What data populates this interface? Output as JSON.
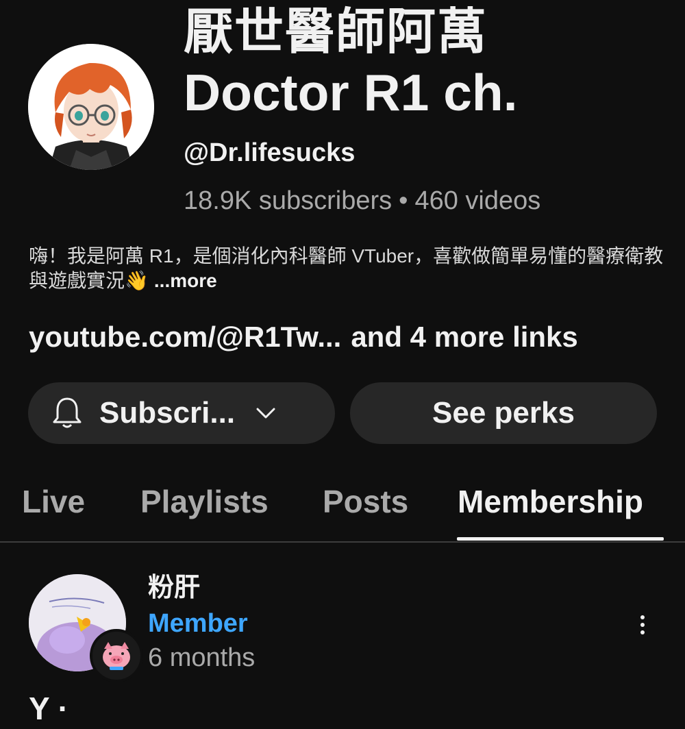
{
  "channel": {
    "title_zh": "厭世醫師阿萬",
    "title_en": "Doctor R1 ch.",
    "handle": "@Dr.lifesucks",
    "subscribers": "18.9K subscribers",
    "separator": "•",
    "videos": "460 videos",
    "description": "嗨！我是阿萬 R1，是個消化內科醫師 VTuber，喜歡做簡單易懂的醫療衛教與遊戲實況",
    "description_emoji": "👋",
    "more_label": "...more",
    "link_text": "youtube.com/@R1Tw...",
    "more_links_text": "and 4 more links",
    "avatar_icon": "vtuber-avatar"
  },
  "actions": {
    "subscribe_label": "Subscri...",
    "perks_label": "See perks",
    "bell_icon": "bell-icon",
    "chevron_icon": "chevron-down-icon"
  },
  "tabs": [
    {
      "label": "Live",
      "active": false
    },
    {
      "label": "Playlists",
      "active": false
    },
    {
      "label": "Posts",
      "active": false
    },
    {
      "label": "Membership",
      "active": true
    }
  ],
  "member_post": {
    "name": "粉肝",
    "role": "Member",
    "duration": "6 months",
    "badge_icon": "pig-badge-icon",
    "menu_icon": "more-vertical-icon",
    "role_color": "#3ea6ff"
  },
  "cutoff_text": "Y    ·"
}
